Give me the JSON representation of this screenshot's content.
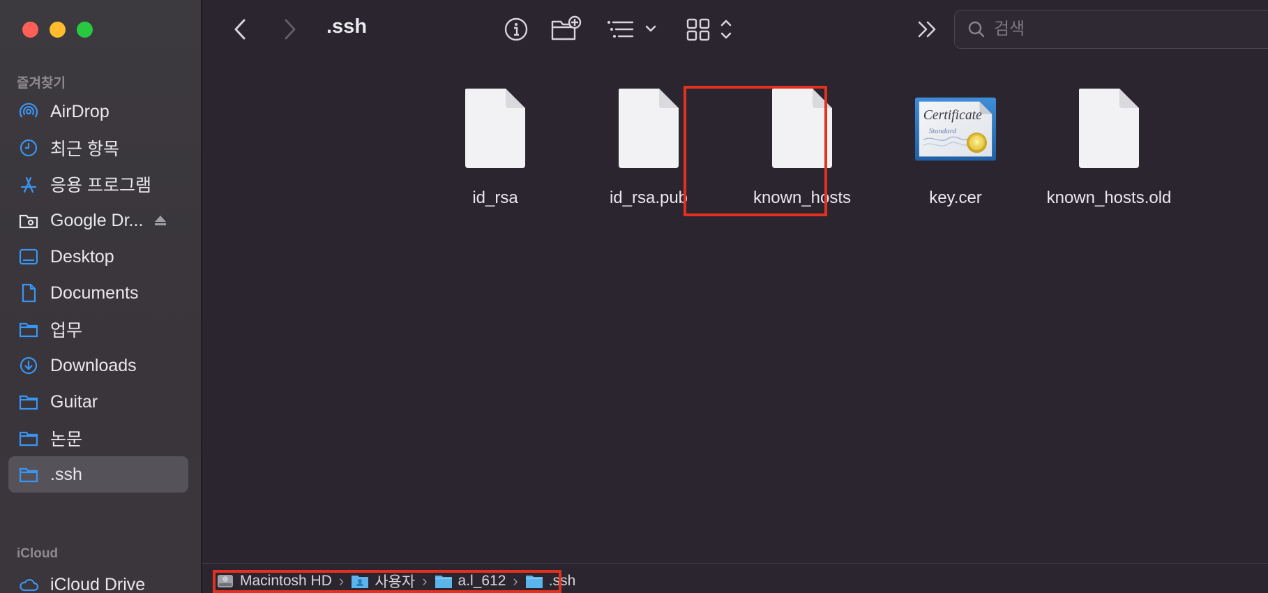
{
  "window": {
    "title": ".ssh"
  },
  "sidebar": {
    "favorites_title": "즐겨찾기",
    "items": [
      {
        "label": "AirDrop",
        "icon": "airdrop-icon"
      },
      {
        "label": "최근 항목",
        "icon": "clock-icon"
      },
      {
        "label": "응용 프로그램",
        "icon": "applications-icon"
      },
      {
        "label": "Google Dr...",
        "icon": "drive-folder-icon",
        "eject": true
      },
      {
        "label": "Desktop",
        "icon": "desktop-icon"
      },
      {
        "label": "Documents",
        "icon": "document-icon"
      },
      {
        "label": "업무",
        "icon": "folder-icon"
      },
      {
        "label": "Downloads",
        "icon": "download-icon"
      },
      {
        "label": "Guitar",
        "icon": "folder-icon"
      },
      {
        "label": "논문",
        "icon": "folder-icon"
      },
      {
        "label": ".ssh",
        "icon": "folder-icon",
        "selected": true
      }
    ],
    "icloud_title": "iCloud",
    "icloud_items": [
      {
        "label": "iCloud Drive",
        "icon": "cloud-icon"
      }
    ]
  },
  "toolbar": {
    "search_placeholder": "검색"
  },
  "files": [
    {
      "name": "id_rsa",
      "type": "generic"
    },
    {
      "name": "id_rsa.pub",
      "type": "generic"
    },
    {
      "name": "known_hosts",
      "type": "generic"
    },
    {
      "name": "key.cer",
      "type": "certificate",
      "certificate_text": "Certificate",
      "certificate_subtext": "Standard"
    },
    {
      "name": "known_hosts.old",
      "type": "generic"
    }
  ],
  "pathbar": {
    "crumbs": [
      "Macintosh HD",
      "사용자",
      "a.l_612",
      ".ssh"
    ]
  },
  "colors": {
    "accent": "#2f8ff0",
    "highlight": "#e2321f",
    "background": "#2b2530"
  }
}
